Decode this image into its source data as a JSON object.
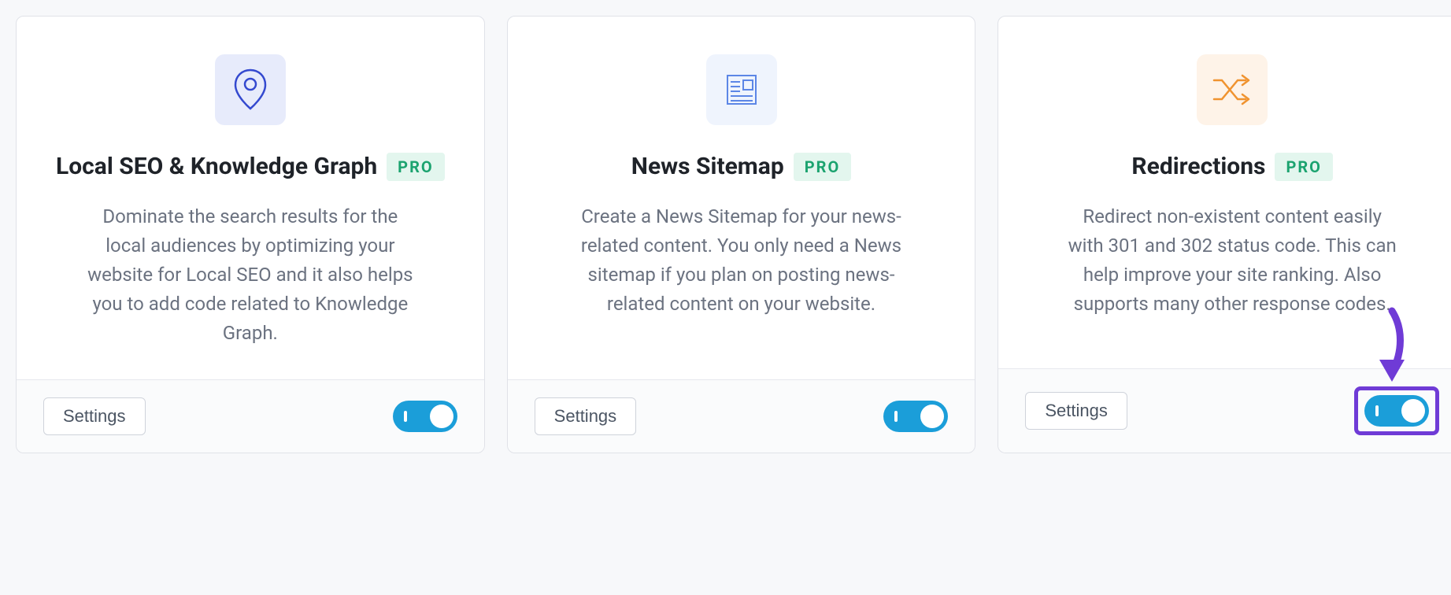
{
  "pro_label": "PRO",
  "settings_label": "Settings",
  "cards": [
    {
      "title": "Local SEO & Knowledge Graph",
      "desc": "Dominate the search results for the local audiences by optimizing your website for Local SEO and it also helps you to add code related to Knowledge Graph."
    },
    {
      "title": "News Sitemap",
      "desc": "Create a News Sitemap for your news-related content. You only need a News sitemap if you plan on posting news-related content on your website."
    },
    {
      "title": "Redirections",
      "desc": "Redirect non-existent content easily with 301 and 302 status code. This can help improve your site ranking. Also supports many other response codes."
    }
  ]
}
